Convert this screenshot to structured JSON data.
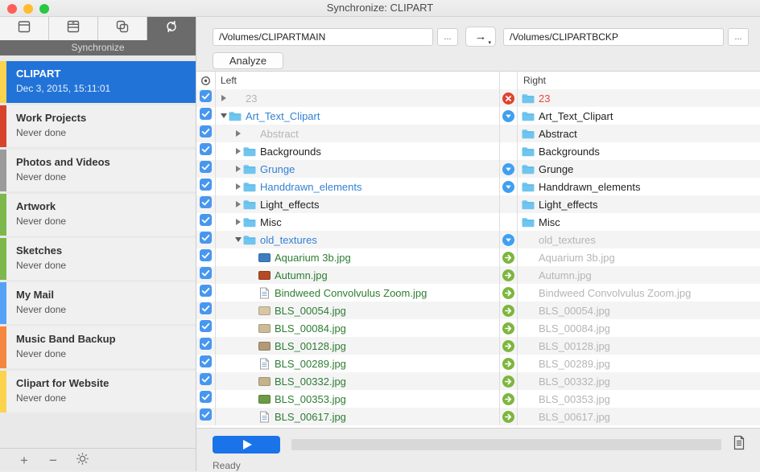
{
  "window": {
    "title": "Synchronize: CLIPART"
  },
  "tabs": [
    {
      "icon": "backup-box-icon",
      "selected": false
    },
    {
      "icon": "archive-drawer-icon",
      "selected": false
    },
    {
      "icon": "clone-copy-icon",
      "selected": false
    },
    {
      "icon": "synchronize-arrows-icon",
      "selected": true
    }
  ],
  "mode_label": "Synchronize",
  "sidebar": {
    "items": [
      {
        "name": "CLIPART",
        "status": "Dec 3, 2015, 15:11:01",
        "color": "#fbd34d",
        "selected": true
      },
      {
        "name": "Work Projects",
        "status": "Never done",
        "color": "#d8432d",
        "selected": false
      },
      {
        "name": "Photos and Videos",
        "status": "Never done",
        "color": "#9b9b9b",
        "selected": false
      },
      {
        "name": "Artwork",
        "status": "Never done",
        "color": "#7cb84b",
        "selected": false
      },
      {
        "name": "Sketches",
        "status": "Never done",
        "color": "#7cb84b",
        "selected": false
      },
      {
        "name": "My Mail",
        "status": "Never done",
        "color": "#56a1f6",
        "selected": false
      },
      {
        "name": "Music Band Backup",
        "status": "Never done",
        "color": "#f6853f",
        "selected": false
      },
      {
        "name": "Clipart for Website",
        "status": "Never done",
        "color": "#fbd34d",
        "selected": false
      }
    ],
    "add_label": "+",
    "remove_label": "−"
  },
  "toolbar": {
    "left_path": "/Volumes/CLIPARTMAIN",
    "right_path": "/Volumes/CLIPARTBCKP",
    "browse_label": "...",
    "direction_arrow": "→",
    "direction_caret": "▾",
    "analyze_label": "Analyze"
  },
  "list": {
    "left_header": "Left",
    "right_header": "Right",
    "rows": [
      {
        "indent": 0,
        "disclosure": "collapsed",
        "checked": true,
        "status": "delete",
        "left": {
          "text": "23",
          "style": "missing",
          "icon": "none"
        },
        "right": {
          "text": "23",
          "style": "delete",
          "icon": "folder"
        }
      },
      {
        "indent": 0,
        "disclosure": "expanded",
        "checked": true,
        "status": "update",
        "left": {
          "text": "Art_Text_Clipart",
          "style": "changed",
          "icon": "folder"
        },
        "right": {
          "text": "Art_Text_Clipart",
          "style": "normal",
          "icon": "folder"
        }
      },
      {
        "indent": 1,
        "disclosure": "collapsed",
        "checked": true,
        "status": "none",
        "left": {
          "text": "Abstract",
          "style": "missing",
          "icon": "none"
        },
        "right": {
          "text": "Abstract",
          "style": "normal",
          "icon": "folder"
        }
      },
      {
        "indent": 1,
        "disclosure": "collapsed",
        "checked": true,
        "status": "none",
        "left": {
          "text": "Backgrounds",
          "style": "normal",
          "icon": "folder"
        },
        "right": {
          "text": "Backgrounds",
          "style": "normal",
          "icon": "folder"
        }
      },
      {
        "indent": 1,
        "disclosure": "collapsed",
        "checked": true,
        "status": "update",
        "left": {
          "text": "Grunge",
          "style": "changed",
          "icon": "folder"
        },
        "right": {
          "text": "Grunge",
          "style": "normal",
          "icon": "folder"
        }
      },
      {
        "indent": 1,
        "disclosure": "collapsed",
        "checked": true,
        "status": "update",
        "left": {
          "text": "Handdrawn_elements",
          "style": "changed",
          "icon": "folder"
        },
        "right": {
          "text": "Handdrawn_elements",
          "style": "normal",
          "icon": "folder"
        }
      },
      {
        "indent": 1,
        "disclosure": "collapsed",
        "checked": true,
        "status": "none",
        "left": {
          "text": "Light_effects",
          "style": "normal",
          "icon": "folder"
        },
        "right": {
          "text": "Light_effects",
          "style": "normal",
          "icon": "folder"
        }
      },
      {
        "indent": 1,
        "disclosure": "collapsed",
        "checked": true,
        "status": "none",
        "left": {
          "text": "Misc",
          "style": "normal",
          "icon": "folder"
        },
        "right": {
          "text": "Misc",
          "style": "normal",
          "icon": "folder"
        }
      },
      {
        "indent": 1,
        "disclosure": "expanded",
        "checked": true,
        "status": "update",
        "left": {
          "text": "old_textures",
          "style": "changed",
          "icon": "folder"
        },
        "right": {
          "text": "old_textures",
          "style": "missing",
          "icon": "none"
        }
      },
      {
        "indent": 2,
        "disclosure": "none",
        "checked": true,
        "status": "copy",
        "left": {
          "text": "Aquarium 3b.jpg",
          "style": "new",
          "icon": "thumb",
          "thumb": "#3f7fc1"
        },
        "right": {
          "text": "Aquarium 3b.jpg",
          "style": "missing",
          "icon": "none"
        }
      },
      {
        "indent": 2,
        "disclosure": "none",
        "checked": true,
        "status": "copy",
        "left": {
          "text": "Autumn.jpg",
          "style": "new",
          "icon": "thumb",
          "thumb": "#b54a26"
        },
        "right": {
          "text": "Autumn.jpg",
          "style": "missing",
          "icon": "none"
        }
      },
      {
        "indent": 2,
        "disclosure": "none",
        "checked": true,
        "status": "copy",
        "left": {
          "text": "Bindweed Convolvulus Zoom.jpg",
          "style": "new",
          "icon": "doc"
        },
        "right": {
          "text": "Bindweed Convolvulus Zoom.jpg",
          "style": "missing",
          "icon": "none"
        }
      },
      {
        "indent": 2,
        "disclosure": "none",
        "checked": true,
        "status": "copy",
        "left": {
          "text": "BLS_00054.jpg",
          "style": "new",
          "icon": "thumb",
          "thumb": "#d6c6a4"
        },
        "right": {
          "text": "BLS_00054.jpg",
          "style": "missing",
          "icon": "none"
        }
      },
      {
        "indent": 2,
        "disclosure": "none",
        "checked": true,
        "status": "copy",
        "left": {
          "text": "BLS_00084.jpg",
          "style": "new",
          "icon": "thumb",
          "thumb": "#cbbb97"
        },
        "right": {
          "text": "BLS_00084.jpg",
          "style": "missing",
          "icon": "none"
        }
      },
      {
        "indent": 2,
        "disclosure": "none",
        "checked": true,
        "status": "copy",
        "left": {
          "text": "BLS_00128.jpg",
          "style": "new",
          "icon": "thumb",
          "thumb": "#b29a77"
        },
        "right": {
          "text": "BLS_00128.jpg",
          "style": "missing",
          "icon": "none"
        }
      },
      {
        "indent": 2,
        "disclosure": "none",
        "checked": true,
        "status": "copy",
        "left": {
          "text": "BLS_00289.jpg",
          "style": "new",
          "icon": "doc"
        },
        "right": {
          "text": "BLS_00289.jpg",
          "style": "missing",
          "icon": "none"
        }
      },
      {
        "indent": 2,
        "disclosure": "none",
        "checked": true,
        "status": "copy",
        "left": {
          "text": "BLS_00332.jpg",
          "style": "new",
          "icon": "thumb",
          "thumb": "#c4b28d"
        },
        "right": {
          "text": "BLS_00332.jpg",
          "style": "missing",
          "icon": "none"
        }
      },
      {
        "indent": 2,
        "disclosure": "none",
        "checked": true,
        "status": "copy",
        "left": {
          "text": "BLS_00353.jpg",
          "style": "new",
          "icon": "thumb",
          "thumb": "#6d9a44"
        },
        "right": {
          "text": "BLS_00353.jpg",
          "style": "missing",
          "icon": "none"
        }
      },
      {
        "indent": 2,
        "disclosure": "none",
        "checked": true,
        "status": "copy",
        "left": {
          "text": "BLS_00617.jpg",
          "style": "new",
          "icon": "doc"
        },
        "right": {
          "text": "BLS_00617.jpg",
          "style": "missing",
          "icon": "none"
        }
      }
    ]
  },
  "footer": {
    "status": "Ready"
  },
  "colors": {
    "selected_item": "#2273d8",
    "checkbox": "#4897ef",
    "folder": "#70c5ef",
    "status_delete": "#e0432f",
    "status_update": "#3fa0f0",
    "status_copy": "#7db63c",
    "play_button": "#1a73e8",
    "traffic_red": "#ff5f57",
    "traffic_yellow": "#febc2e",
    "traffic_green": "#28c840"
  }
}
